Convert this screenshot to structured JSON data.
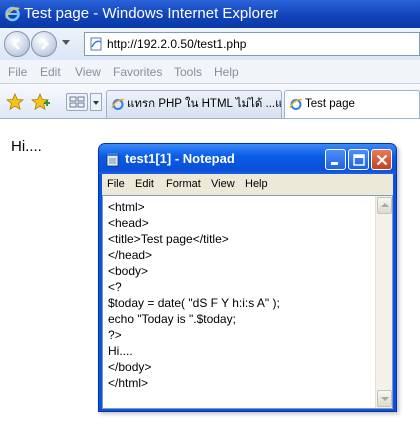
{
  "browser": {
    "title": "Test page - Windows Internet Explorer",
    "address": "http://192.2.0.50/test1.php",
    "menu": [
      "File",
      "Edit",
      "View",
      "Favorites",
      "Tools",
      "Help"
    ],
    "tabs": [
      {
        "label": "แทรก PHP ใน HTML ไม่ได้ ...แ...",
        "active": false
      },
      {
        "label": "Test page",
        "active": true
      }
    ]
  },
  "page": {
    "text": "Hi...."
  },
  "notepad": {
    "title": "test1[1] - Notepad",
    "menu": [
      "File",
      "Edit",
      "Format",
      "View",
      "Help"
    ],
    "content": "<html>\n<head>\n<title>Test page</title>\n</head>\n<body>\n<?\n$today = date( \"dS F Y h:i:s A\" );\necho \"Today is \".$today;\n?>\nHi....\n</body>\n</html>"
  },
  "colors": {
    "xp_title_blue": "#0a5de8",
    "xp_close_red": "#c2401f",
    "ie_title_blue": "#1042b8"
  }
}
